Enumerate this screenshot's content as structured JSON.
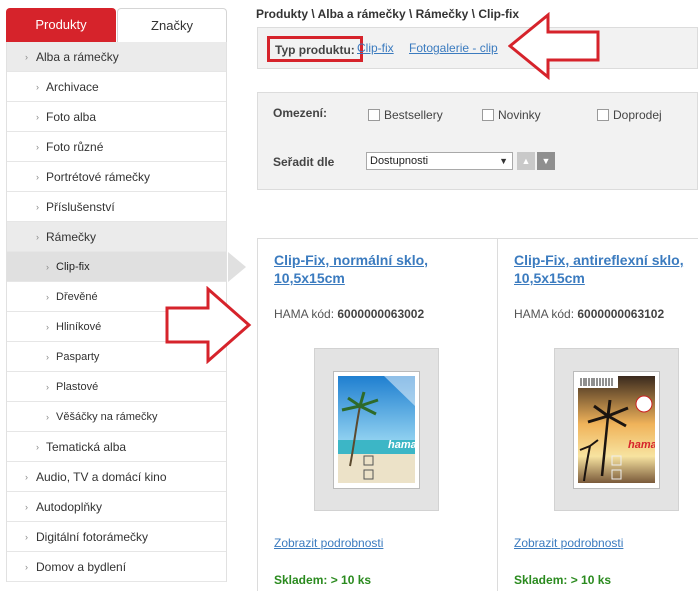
{
  "tabs": {
    "products": "Produkty",
    "brands": "Značky"
  },
  "categories": [
    {
      "label": "Alba a rámečky",
      "level": 0,
      "state": "open"
    },
    {
      "label": "Archivace",
      "level": 1,
      "state": ""
    },
    {
      "label": "Foto alba",
      "level": 1,
      "state": ""
    },
    {
      "label": "Foto různé",
      "level": 1,
      "state": ""
    },
    {
      "label": "Portrétové rámečky",
      "level": 1,
      "state": ""
    },
    {
      "label": "Příslušenství",
      "level": 1,
      "state": ""
    },
    {
      "label": "Rámečky",
      "level": 1,
      "state": "open"
    },
    {
      "label": "Clip-fix",
      "level": 2,
      "state": "selected"
    },
    {
      "label": "Dřevěné",
      "level": 2,
      "state": ""
    },
    {
      "label": "Hliníkové",
      "level": 2,
      "state": ""
    },
    {
      "label": "Pasparty",
      "level": 2,
      "state": ""
    },
    {
      "label": "Plastové",
      "level": 2,
      "state": ""
    },
    {
      "label": "Věšáčky na rámečky",
      "level": 2,
      "state": ""
    },
    {
      "label": "Tematická alba",
      "level": 1,
      "state": ""
    },
    {
      "label": "Audio, TV a domácí kino",
      "level": 0,
      "state": ""
    },
    {
      "label": "Autodoplňky",
      "level": 0,
      "state": ""
    },
    {
      "label": "Digitální fotorámečky",
      "level": 0,
      "state": ""
    },
    {
      "label": "Domov a bydlení",
      "level": 0,
      "state": ""
    }
  ],
  "breadcrumb": "Produkty \\ Alba a rámečky \\ Rámečky \\ Clip-fix",
  "product_type": {
    "label": "Typ produktu:",
    "links": [
      "Clip-fix",
      "Fotogalerie - clip"
    ]
  },
  "filters": {
    "restriction_label": "Omezení:",
    "checkboxes": [
      "Bestsellery",
      "Novinky",
      "Doprodej"
    ],
    "sort_label": "Seřadit dle",
    "sort_value": "Dostupnosti"
  },
  "products": [
    {
      "title": "Clip-Fix, normální sklo, 10,5x15cm",
      "code_label": "HAMA kód:",
      "code": "6000000063002",
      "detail_link": "Zobrazit podrobnosti",
      "stock_label": "Skladem:",
      "stock_value": "> 10  ks",
      "image_brand": "hama."
    },
    {
      "title": "Clip-Fix, antireflexní sklo, 10,5x15cm",
      "code_label": "HAMA kód:",
      "code": "6000000063102",
      "detail_link": "Zobrazit podrobnosti",
      "stock_label": "Skladem:",
      "stock_value": "> 10  ks",
      "image_brand": "hama."
    }
  ],
  "icons": {
    "collapsed": "triangle-right-icon",
    "sort_up": "sort-up-icon",
    "sort_down": "sort-down-icon",
    "select_caret": "chevron-down-icon"
  },
  "colors": {
    "accent_red": "#d6232b",
    "link_blue": "#3b7bbf",
    "stock_green": "#2a8a1e",
    "panel_gray": "#f2f2f2"
  }
}
